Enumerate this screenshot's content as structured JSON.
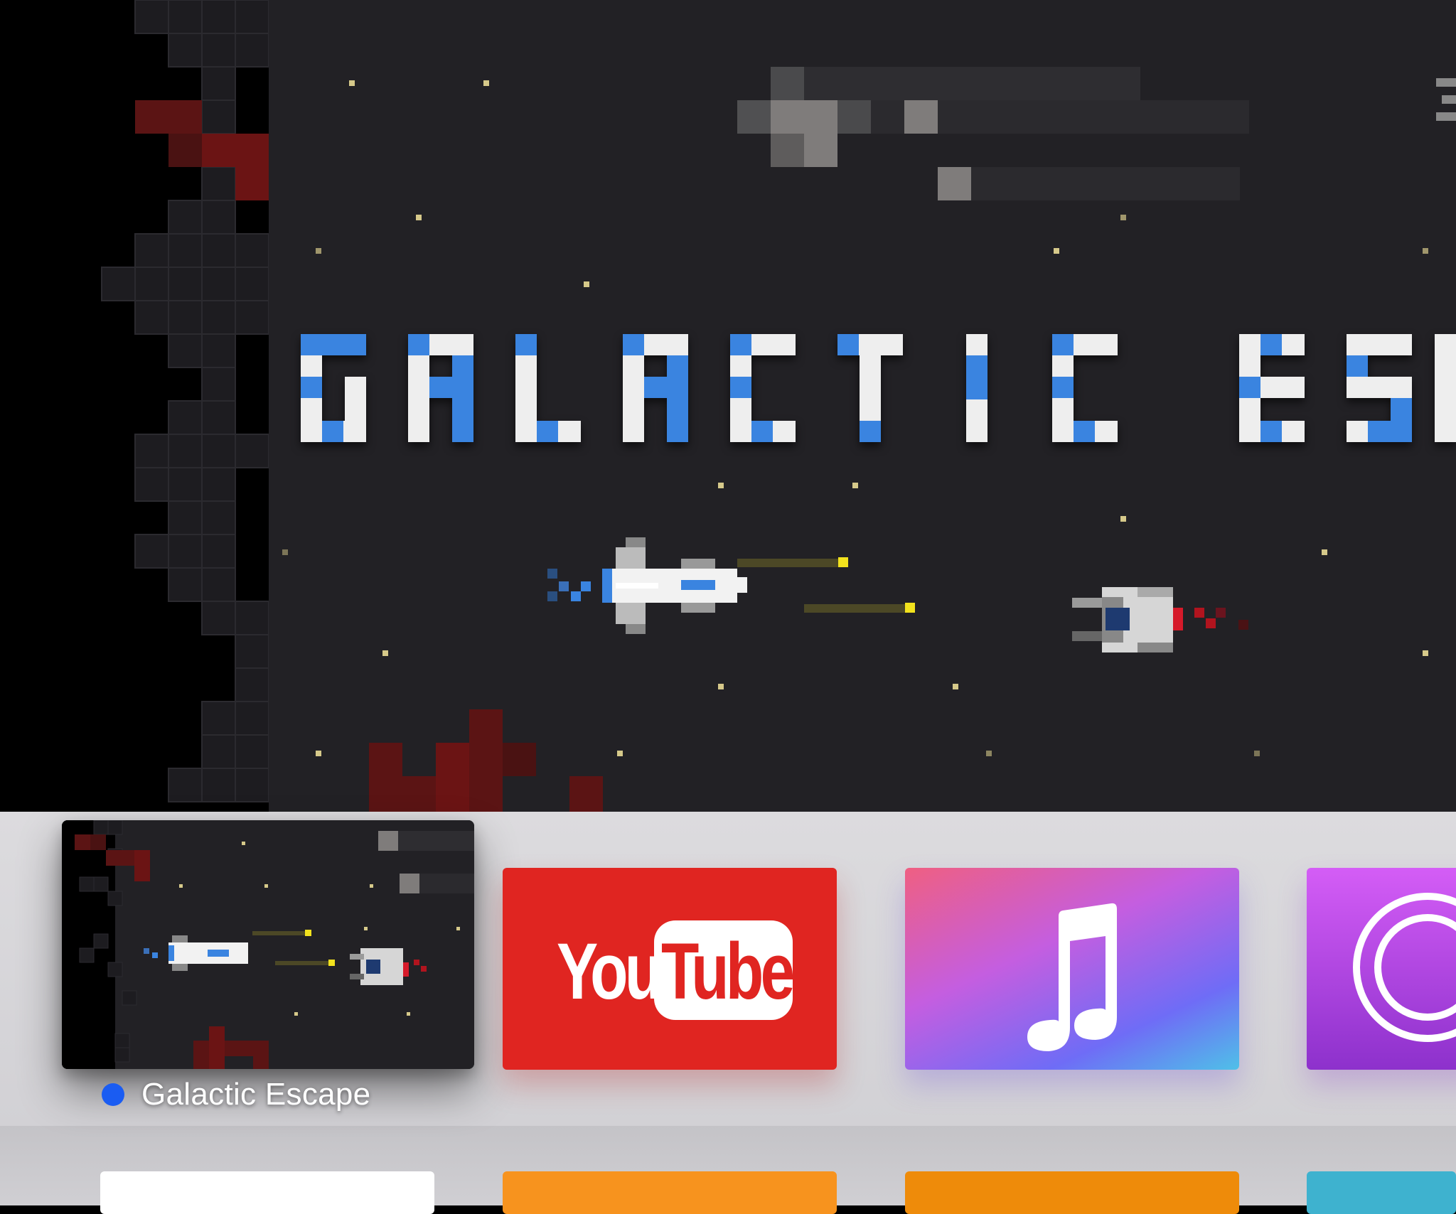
{
  "hero": {
    "game_title_art": "GALACTIC ESCAPE"
  },
  "top_shelf": {
    "focused_app": {
      "name": "Galactic Escape",
      "status": "new-update-indicator"
    },
    "apps": [
      {
        "name": "YouTube",
        "logo_text_left": "You",
        "logo_text_right": "Tube",
        "color": "#e02521"
      },
      {
        "name": "Music",
        "icon": "music-note-icon"
      },
      {
        "name": "Podcasts",
        "icon": "podcasts-icon"
      }
    ]
  },
  "second_row": {
    "tiles": [
      {
        "color": "#ffffff"
      },
      {
        "color": "#f7931e"
      },
      {
        "color": "#ee8b0a"
      },
      {
        "color": "#3eb2cf"
      }
    ]
  },
  "colors": {
    "space_bg": "#222125",
    "title_blue": "#3a84e0",
    "title_white": "#eeeeee",
    "shelf_bg": "#d8d7db",
    "focus_dot": "#1a5cf2"
  }
}
